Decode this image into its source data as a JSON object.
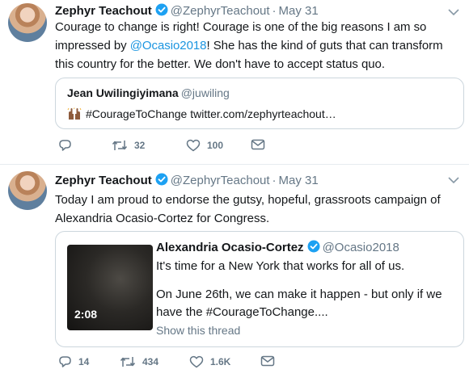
{
  "tweets": [
    {
      "author": "Zephyr Teachout",
      "handle": "@ZephyrTeachout",
      "separator": "·",
      "date": "May 31",
      "text_before_link": "Courage to change is right! Courage is one of the big reasons I am so impressed by ",
      "mention": "@Ocasio2018",
      "text_after_link": "! She has the kind of guts that can transform this country for the better. We don't have to accept status quo.",
      "quoted": {
        "author": "Jean Uwilingiyimana",
        "handle": "@juwiling",
        "text": "#CourageToChange twitter.com/zephyrteachout…"
      },
      "actions": {
        "replies": "",
        "retweets": "32",
        "likes": "100"
      }
    },
    {
      "author": "Zephyr Teachout",
      "handle": "@ZephyrTeachout",
      "separator": "·",
      "date": "May 31",
      "text": "Today I am proud to endorse the gutsy, hopeful, grassroots campaign of Alexandria Ocasio-Cortez for Congress.",
      "quoted": {
        "author": "Alexandria Ocasio-Cortez",
        "handle": "@Ocasio2018",
        "line1": "It's time for a New York that works for all of us.",
        "line2": "On June 26th, we can make it happen - but only if we have the #CourageToChange....",
        "video_duration": "2:08",
        "thread_link": "Show this thread"
      },
      "actions": {
        "replies": "14",
        "retweets": "434",
        "likes": "1.6K"
      }
    }
  ],
  "colors": {
    "link": "#1b95e0",
    "secondary": "#657786",
    "border": "#e6ecf0",
    "verified": "#1da1f2"
  },
  "icons": [
    "reply-icon",
    "retweet-icon",
    "like-icon",
    "message-icon",
    "verified-badge-icon",
    "caret-down-icon",
    "raised-hands-emoji"
  ]
}
